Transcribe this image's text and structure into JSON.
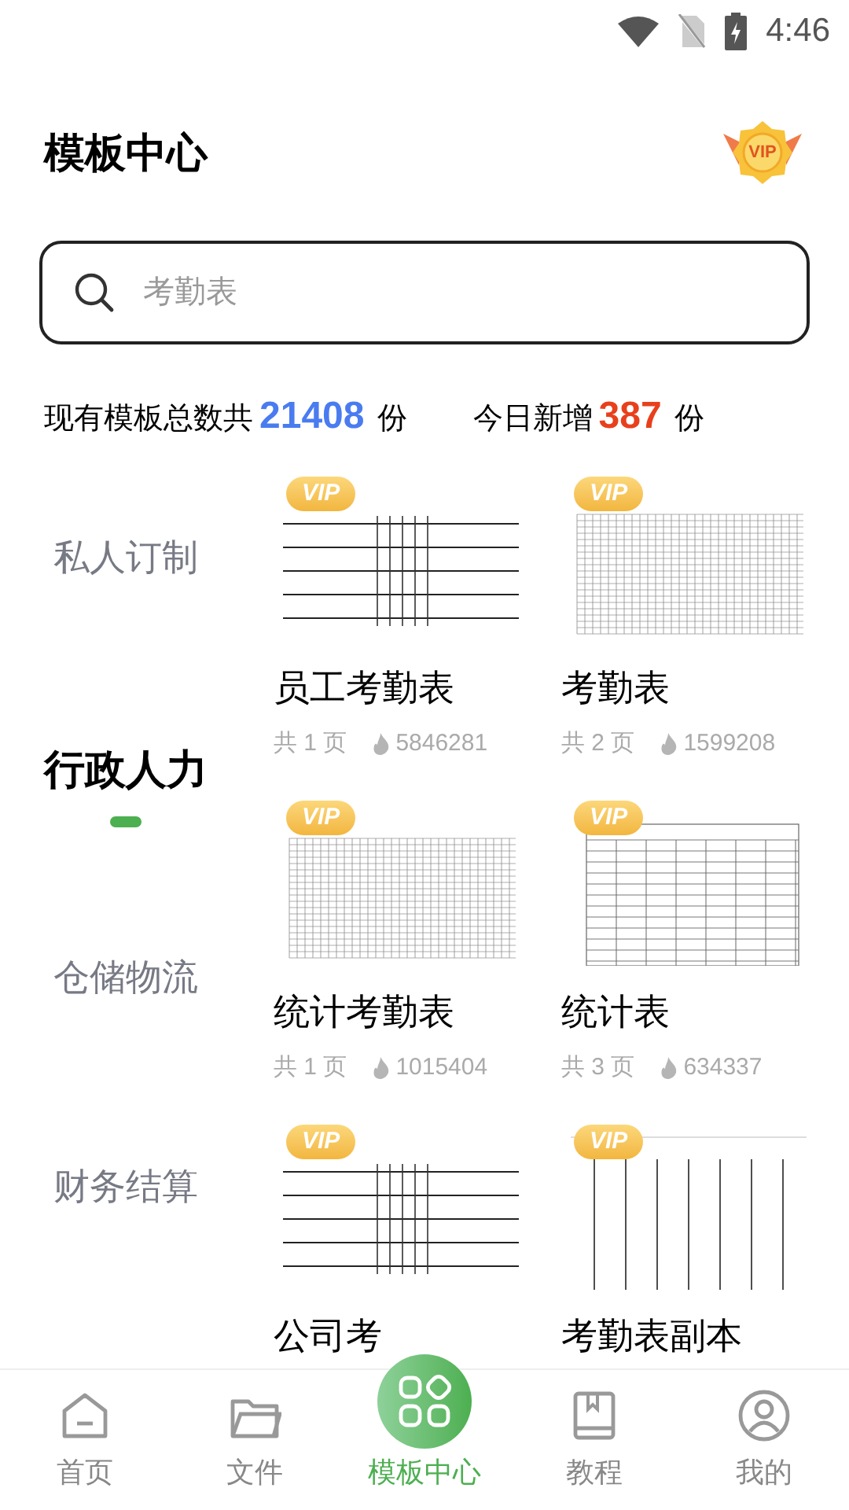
{
  "status_bar": {
    "time": "4:46"
  },
  "header": {
    "title": "模板中心",
    "vip_badge": "VIP"
  },
  "search": {
    "placeholder": "考勤表"
  },
  "stats": {
    "total_label": "现有模板总数共",
    "total": "21408",
    "total_unit": "份",
    "new_label": "今日新增",
    "new": "387",
    "new_unit": "份"
  },
  "categories": [
    {
      "label": "私人订制",
      "selected": false
    },
    {
      "label": "行政人力",
      "selected": true
    },
    {
      "label": "仓储物流",
      "selected": false
    },
    {
      "label": "财务结算",
      "selected": false
    }
  ],
  "templates": [
    {
      "title": "员工考勤表",
      "badge": "VIP",
      "pages": "共 1 页",
      "views": "5846281",
      "kind": "wide"
    },
    {
      "title": "考勤表",
      "badge": "VIP",
      "pages": "共 2 页",
      "views": "1599208",
      "kind": "dense"
    },
    {
      "title": "统计考勤表",
      "badge": "VIP",
      "pages": "共 1 页",
      "views": "1015404",
      "kind": "dense"
    },
    {
      "title": "统计表",
      "badge": "VIP",
      "pages": "共 3 页",
      "views": "634337",
      "kind": "table"
    },
    {
      "title": "公司考",
      "badge": "VIP",
      "kind": "wide"
    },
    {
      "title": "考勤表副本",
      "badge": "VIP",
      "kind": "columns"
    }
  ],
  "nav": [
    {
      "label": "首页",
      "selected": false
    },
    {
      "label": "文件",
      "selected": false
    },
    {
      "label": "模板中心",
      "selected": true
    },
    {
      "label": "教程",
      "selected": false
    },
    {
      "label": "我的",
      "selected": false
    }
  ]
}
